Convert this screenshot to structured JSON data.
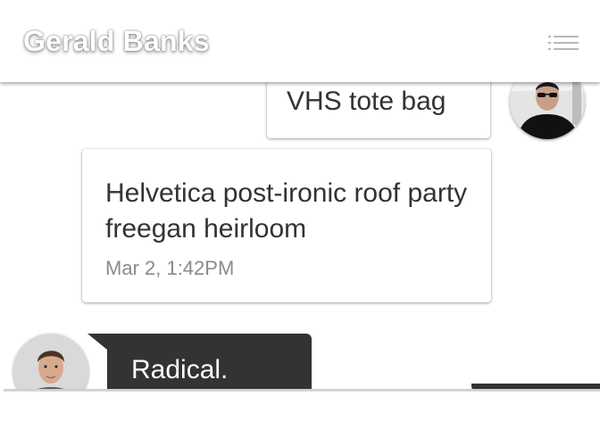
{
  "header": {
    "contact_name": "Gerald Banks",
    "menu_icon": "hamburger-menu-icon"
  },
  "messages": [
    {
      "sender": "self",
      "text": "VHS tote bag",
      "time": ""
    },
    {
      "sender": "self",
      "text": "Helvetica post-ironic roof party freegan heirloom",
      "time": "Mar 2, 1:42PM"
    },
    {
      "sender": "contact",
      "text": "Radical.",
      "time": ""
    }
  ],
  "colors": {
    "header_bg": "#ffffff",
    "light_bubble_bg": "#ffffff",
    "dark_bubble_bg": "#333333",
    "message_text": "#333333",
    "timestamp_text": "#8a8a8a"
  }
}
